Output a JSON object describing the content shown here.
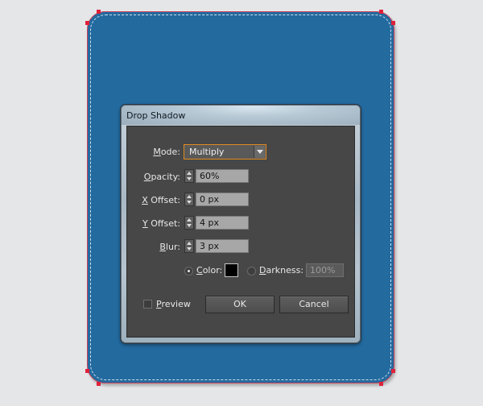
{
  "dialog": {
    "title": "Drop Shadow",
    "mode": {
      "label": "Mode:",
      "value": "Multiply"
    },
    "opacity": {
      "label": "Opacity:",
      "value": "60%"
    },
    "x_offset": {
      "label": "X Offset:",
      "value": "0 px"
    },
    "y_offset": {
      "label": "Y Offset:",
      "value": "4 px"
    },
    "blur": {
      "label": "Blur:",
      "value": "3 px"
    },
    "color": {
      "label": "Color:",
      "selected": true,
      "swatch": "#000000"
    },
    "darkness": {
      "label": "Darkness:",
      "value": "100%",
      "selected": false
    },
    "preview": {
      "label": "Preview",
      "checked": false
    },
    "ok_label": "OK",
    "cancel_label": "Cancel"
  },
  "colors": {
    "artboard": "#236a9f",
    "selection": "#e0203a",
    "focus": "#e08a1e"
  }
}
